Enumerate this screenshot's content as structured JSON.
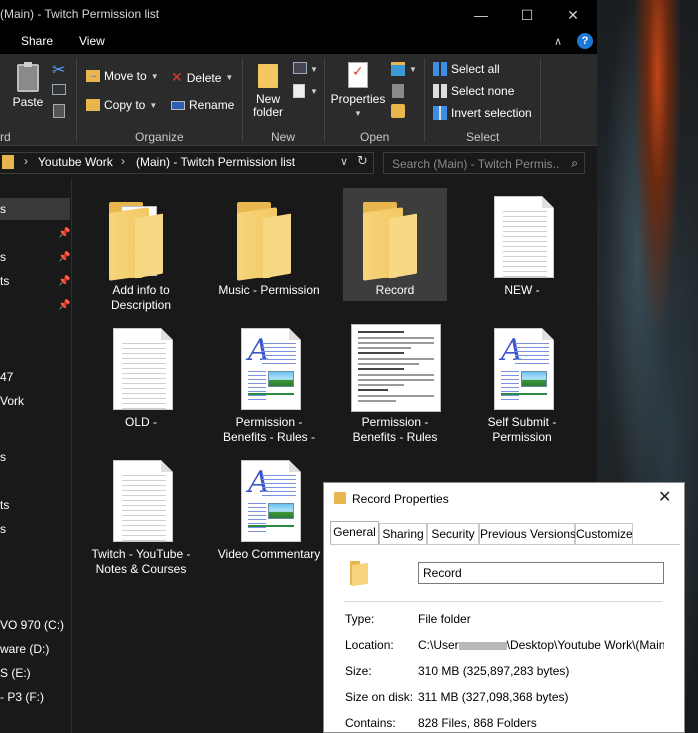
{
  "window": {
    "title": "(Main) - Twitch Permission list"
  },
  "ribbon_tabs": [
    "Share",
    "View"
  ],
  "ribbon": {
    "clipboard": {
      "paste": "Paste",
      "group_tail": "rd"
    },
    "organize": {
      "move_to": "Move to",
      "copy_to": "Copy to",
      "delete": "Delete",
      "rename": "Rename",
      "label": "Organize"
    },
    "new": {
      "new_folder_l1": "New",
      "new_folder_l2": "folder",
      "label": "New"
    },
    "open": {
      "properties": "Properties",
      "label": "Open"
    },
    "select": {
      "select_all": "Select all",
      "select_none": "Select none",
      "invert": "Invert selection",
      "label": "Select"
    }
  },
  "address": {
    "crumbs": [
      "Youtube Work",
      "(Main) - Twitch Permission list"
    ],
    "search_placeholder": "Search (Main) - Twitch Permis..."
  },
  "nav": {
    "items": [
      "s",
      "s",
      "ts",
      "47",
      "Vork",
      "s",
      "ts",
      "s",
      "VO 970 (C:)",
      "ware (D:)",
      "S (E:)",
      "- P3 (F:)"
    ]
  },
  "files": [
    {
      "label": "Add info to Description",
      "kind": "folder"
    },
    {
      "label": "Music - Permission",
      "kind": "folder"
    },
    {
      "label": "Record",
      "kind": "folder",
      "selected": true
    },
    {
      "label": "NEW -",
      "kind": "text"
    },
    {
      "label": "OLD -",
      "kind": "text"
    },
    {
      "label": "Permission - Benefits - Rules -",
      "kind": "wordpad"
    },
    {
      "label": "Permission - Benefits - Rules",
      "kind": "thumbnail"
    },
    {
      "label": "Self Submit - Permission",
      "kind": "wordpad"
    },
    {
      "label": "Twitch - YouTube - Notes & Courses",
      "kind": "text"
    },
    {
      "label": "Video Commentary",
      "kind": "wordpad"
    }
  ],
  "dialog": {
    "title": "Record Properties",
    "tabs": [
      "General",
      "Sharing",
      "Security",
      "Previous Versions",
      "Customize"
    ],
    "name_value": "Record",
    "props": {
      "type_label": "Type:",
      "type_value": "File folder",
      "location_label": "Location:",
      "location_prefix": "C:\\User",
      "location_suffix": "\\Desktop\\Youtube Work\\(Main) - Tw",
      "size_label": "Size:",
      "size_value": "310 MB (325,897,283 bytes)",
      "size_disk_label": "Size on disk:",
      "size_disk_value": "311 MB (327,098,368 bytes)",
      "contains_label": "Contains:",
      "contains_value": "828 Files, 868 Folders"
    }
  },
  "colors": {
    "explorer_bg": "#191919",
    "ribbon_bg": "#2b2b2b",
    "selection": "#3d3d3d",
    "folder": "#f3c862",
    "accent": "#1e78d7"
  }
}
